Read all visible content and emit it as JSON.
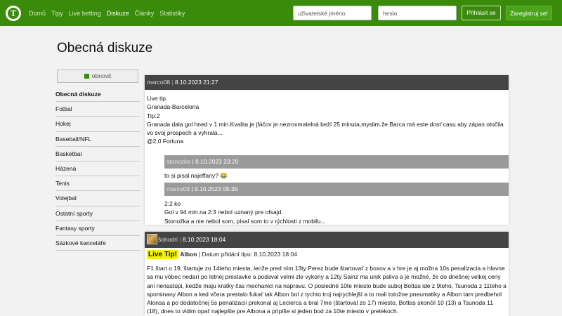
{
  "header": {
    "logo_letter": "T",
    "nav": [
      {
        "label": "Domů",
        "active": false
      },
      {
        "label": "Tipy",
        "active": false
      },
      {
        "label": "Live betting",
        "active": false
      },
      {
        "label": "Diskuze",
        "active": true
      },
      {
        "label": "Články",
        "active": false
      },
      {
        "label": "Statistiky",
        "active": false
      }
    ],
    "username_placeholder": "uživatelské jméno",
    "password_placeholder": "heslo",
    "login_label": "Přihlásit se",
    "register_label": "Zaregistruj se!"
  },
  "page": {
    "title": "Obecná diskuze"
  },
  "sidebar": {
    "refresh_label": "obnovit",
    "categories": [
      {
        "label": "Obecná diskuze",
        "active": true
      },
      {
        "label": "Fotbal",
        "active": false
      },
      {
        "label": "Hokej",
        "active": false
      },
      {
        "label": "Baseball/NFL",
        "active": false
      },
      {
        "label": "Basketbal",
        "active": false
      },
      {
        "label": "Házená",
        "active": false
      },
      {
        "label": "Tenis",
        "active": false
      },
      {
        "label": "Volejbal",
        "active": false
      },
      {
        "label": "Ostatní sporty",
        "active": false
      },
      {
        "label": "Fantasy sporty",
        "active": false
      },
      {
        "label": "Sázkové kanceláře",
        "active": false
      }
    ]
  },
  "posts": [
    {
      "user": "marco08",
      "date": "8.10.2023 21:27",
      "lines": [
        "Live tip.",
        "Granada-Barcelona",
        "Tip:2",
        "Granada dala gol hned v 1 min.Kvalita je jfáčov je nezrovmatelná beží 25 minuta,myslim.že Barca má este dosť casu aby zápas otočila vo svoj prospech a vyhrala...",
        "@2,0 Fortuna"
      ],
      "replies": [
        {
          "user": "stonozka",
          "date": "8.10.2023 23:20",
          "lines": [
            "to si pisal najeffany? 😂"
          ]
        },
        {
          "user": "marco08",
          "date": "9.10.2023 05:39",
          "lines": [
            "2:2 ko",
            "Gol v 94 min.na 2:3 nebol uznaný pre ofsajd.",
            "Stonožka a nie nebol som, písal som to v rýchlosti z mobilu..."
          ]
        }
      ]
    },
    {
      "user": "šohodri",
      "date": "8.10.2023 18:04",
      "live_badge": "Live Tip!",
      "tip_title": "Albon",
      "tip_meta": "| Datum přidání tipu: 8.10.2023 18:04",
      "text": "F1 štart o 19, štartuje zo 14teho miesta, lenže pred ním 13ty Perez bude štartovať z boxov a v hre je aj možna 10s penalizacia a hlavne sa mu vôbec nedarí po letnej prestavke a podaval velmi zle vykony a 12ty Sainz ma unik paliva a je možné, že do dnešnej velkej ceny ani nenastúpi, kedže maju kratky čas mechanici na napravu. O posledné 10te miesto bude suboj Bottas ide z 9teho, Tsunoda z 11teho a spominany Albon a ked včera prestalo fukať tak Albon bol z tychto troj najrychlejší a to mali totožne pneumatiky a Albon tam predbehol Alonsa a po dodatočnej 5s penalizacii prekonal aj Leclerca a bral 7me (štartoval zo 17) miesto, Bottas skončil 10 (13) a Tsunoda 11 (18), dnes to vidim opať najlepšie pre Albona a pripíše si jeden bod za 10te miesto v pretekoch."
    }
  ]
}
